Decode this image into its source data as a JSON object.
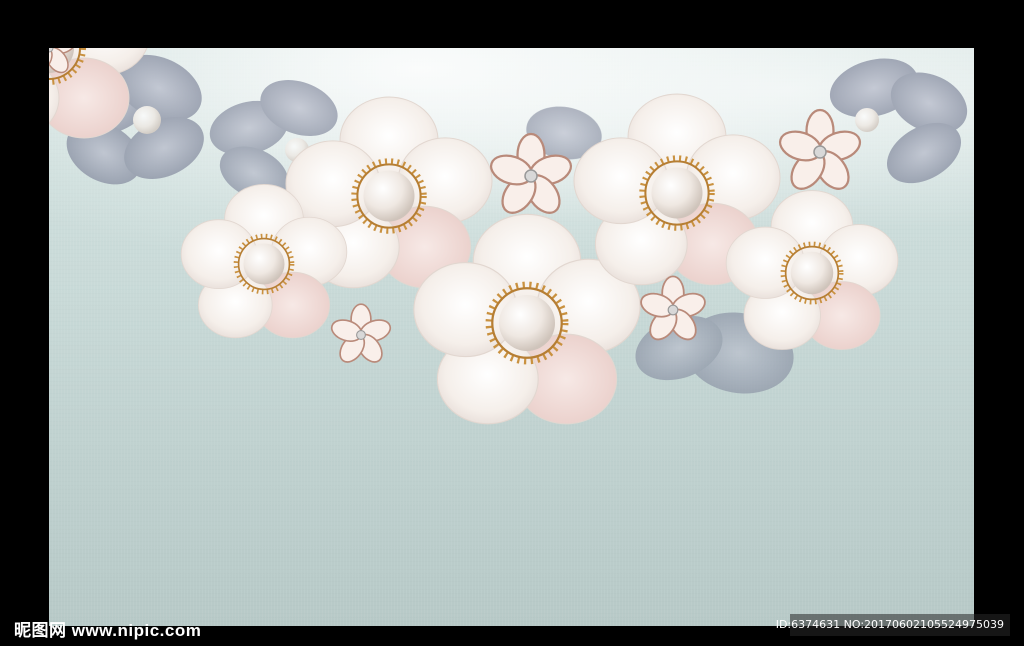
{
  "image": {
    "description_hidden": "",
    "background_color": "#c9dad8",
    "frame_color": "#000000",
    "petal_color": "#f7f1ec",
    "petal_blush": "#f2d9d4",
    "pearl_color": "#f4efe9",
    "gold_color": "#c9913f",
    "lace_color": "#8d93a6"
  },
  "watermark": {
    "logo_cn": "昵图网",
    "logo_url": "www.nipic.com",
    "id_text": "ID:6374631 NO:20170602105524975039"
  }
}
